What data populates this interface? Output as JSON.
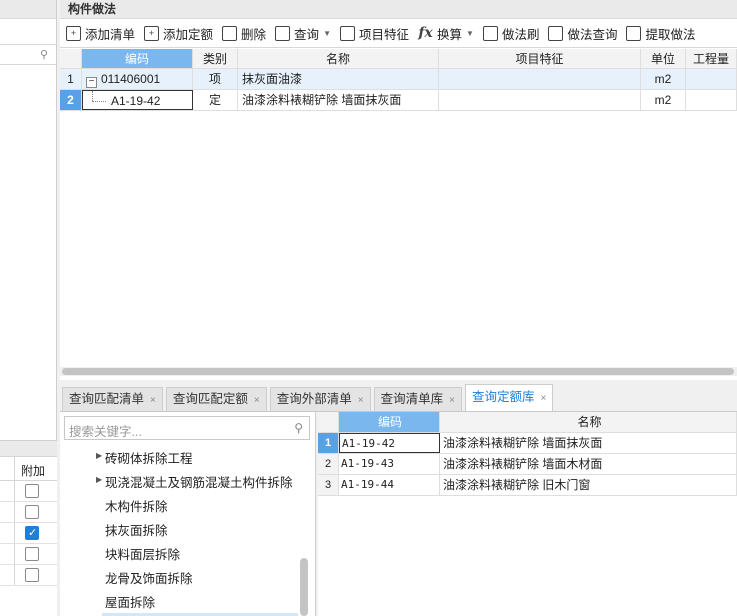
{
  "left": {
    "column_header": "附加",
    "checkboxes": [
      false,
      false,
      true,
      false,
      false
    ]
  },
  "main": {
    "title": "构件做法",
    "toolbar": [
      {
        "label": "添加清单",
        "icon": "add-list-icon",
        "icon_glyph": "+",
        "dropdown": false
      },
      {
        "label": "添加定额",
        "icon": "add-quota-icon",
        "icon_glyph": "+",
        "dropdown": false
      },
      {
        "label": "删除",
        "icon": "trash-icon",
        "icon_glyph": "",
        "dropdown": false
      },
      {
        "label": "查询",
        "icon": "query-icon",
        "icon_glyph": "",
        "dropdown": true
      },
      {
        "label": "项目特征",
        "icon": "feature-icon",
        "icon_glyph": "",
        "dropdown": false
      },
      {
        "label": "换算",
        "icon": "fx-icon",
        "icon_glyph": "fx",
        "dropdown": true
      },
      {
        "label": "做法刷",
        "icon": "brush-icon",
        "icon_glyph": "",
        "dropdown": false
      },
      {
        "label": "做法查询",
        "icon": "method-query-icon",
        "icon_glyph": "",
        "dropdown": false
      },
      {
        "label": "提取做法",
        "icon": "extract-icon",
        "icon_glyph": "",
        "dropdown": false
      }
    ],
    "columns": [
      "编码",
      "类别",
      "名称",
      "项目特征",
      "单位",
      "工程量"
    ],
    "rows": [
      {
        "num": "1",
        "code": "011406001",
        "type": "项",
        "name": "抹灰面油漆",
        "feature": "",
        "unit": "m2",
        "qty": ""
      },
      {
        "num": "2",
        "code": "A1-19-42",
        "type": "定",
        "name": "油漆涂料裱糊铲除 墙面抹灰面",
        "feature": "",
        "unit": "m2",
        "qty": ""
      }
    ]
  },
  "tabs": [
    {
      "label": "查询匹配清单",
      "active": false
    },
    {
      "label": "查询匹配定额",
      "active": false
    },
    {
      "label": "查询外部清单",
      "active": false
    },
    {
      "label": "查询清单库",
      "active": false
    },
    {
      "label": "查询定额库",
      "active": true
    }
  ],
  "tree": {
    "search_placeholder": "搜索关键字...",
    "items": [
      {
        "label": "砖砌体拆除工程",
        "expandable": true
      },
      {
        "label": "现浇混凝土及钢筋混凝土构件拆除",
        "expandable": true
      },
      {
        "label": "木构件拆除",
        "expandable": false
      },
      {
        "label": "抹灰面拆除",
        "expandable": false
      },
      {
        "label": "块料面层拆除",
        "expandable": false
      },
      {
        "label": "龙骨及饰面拆除",
        "expandable": false
      },
      {
        "label": "屋面拆除",
        "expandable": false
      }
    ]
  },
  "library": {
    "columns": [
      "编码",
      "名称"
    ],
    "rows": [
      {
        "num": "1",
        "code": "A1-19-42",
        "name": "油漆涂料裱糊铲除 墙面抹灰面"
      },
      {
        "num": "2",
        "code": "A1-19-43",
        "name": "油漆涂料裱糊铲除 墙面木材面"
      },
      {
        "num": "3",
        "code": "A1-19-44",
        "name": "油漆涂料裱糊铲除 旧木门窗"
      }
    ]
  }
}
